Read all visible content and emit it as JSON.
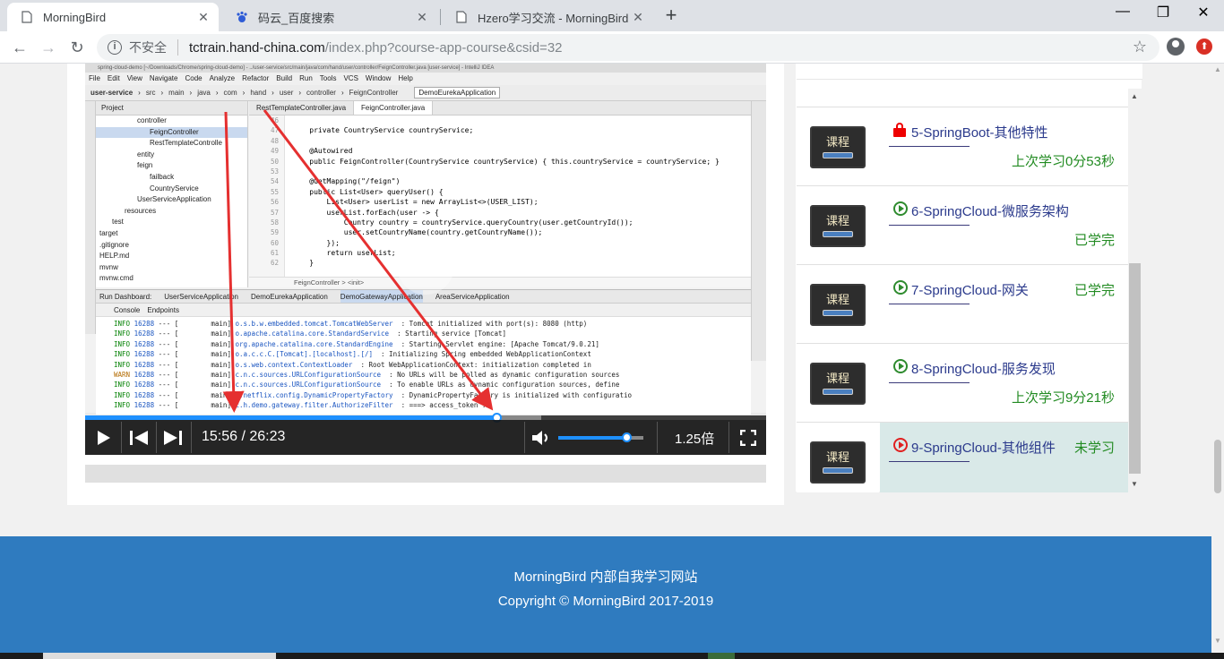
{
  "browser": {
    "tabs": [
      {
        "title": "MorningBird",
        "icon": "page-icon",
        "active": true
      },
      {
        "title": "码云_百度搜索",
        "icon": "baidu-paw-icon",
        "active": false
      },
      {
        "title": "Hzero学习交流 - MorningBird",
        "icon": "page-icon",
        "active": false
      }
    ],
    "new_tab": "+",
    "window_controls": {
      "minimize": "—",
      "restore": "❐",
      "close": "✕"
    },
    "nav": {
      "back": "←",
      "forward": "→",
      "reload": "↻"
    },
    "address": {
      "security_label": "不安全",
      "host": "tctrain.hand-china.com",
      "path": "/index.php?course-app-course&csid=32"
    }
  },
  "ide": {
    "window_title": "spring-cloud-demo [~/Downloads/Chrome/spring-cloud-demo] - ../user-service/src/main/java/com/hand/user/controller/FeignController.java [user-service] - IntelliJ IDEA",
    "menu": [
      "File",
      "Edit",
      "View",
      "Navigate",
      "Code",
      "Analyze",
      "Refactor",
      "Build",
      "Run",
      "Tools",
      "VCS",
      "Window",
      "Help"
    ],
    "breadcrumbs": [
      "user-service",
      "src",
      "main",
      "java",
      "com",
      "hand",
      "user",
      "controller",
      "FeignController"
    ],
    "run_config": "DemoEurekaApplication",
    "project_header": "Project",
    "tree": [
      {
        "label": "controller",
        "indent": 3,
        "selected": false
      },
      {
        "label": "FeignController",
        "indent": 4,
        "selected": true
      },
      {
        "label": "RestTemplateControlle",
        "indent": 4,
        "selected": false
      },
      {
        "label": "entity",
        "indent": 3,
        "selected": false
      },
      {
        "label": "feign",
        "indent": 3,
        "selected": false
      },
      {
        "label": "failback",
        "indent": 4,
        "selected": false
      },
      {
        "label": "CountryService",
        "indent": 4,
        "selected": false
      },
      {
        "label": "UserServiceApplication",
        "indent": 3,
        "selected": false
      },
      {
        "label": "resources",
        "indent": 2,
        "selected": false
      },
      {
        "label": "test",
        "indent": 1,
        "selected": false
      },
      {
        "label": "target",
        "indent": 0,
        "selected": false
      },
      {
        "label": ".gitignore",
        "indent": 0,
        "selected": false
      },
      {
        "label": "HELP.md",
        "indent": 0,
        "selected": false
      },
      {
        "label": "mvnw",
        "indent": 0,
        "selected": false
      },
      {
        "label": "mvnw.cmd",
        "indent": 0,
        "selected": false
      }
    ],
    "editor_tabs": [
      "RestTemplateController.java",
      "FeignController.java"
    ],
    "line_numbers": [
      "46",
      "47",
      "48",
      "49",
      "50",
      "53",
      "54",
      "55",
      "56",
      "57",
      "58",
      "59",
      "60",
      "61",
      "62"
    ],
    "code": [
      "",
      "    private CountryService countryService;",
      "",
      "    @Autowired",
      "    public FeignController(CountryService countryService) { this.countryService = countryService; }",
      "",
      "    @GetMapping(\"/feign\")",
      "    public List<User> queryUser() {",
      "        List<User> userList = new ArrayList<>(USER_LIST);",
      "        userList.forEach(user -> {",
      "            Country country = countryService.queryCountry(user.getCountryId());",
      "            user.setCountryName(country.getCountryName());",
      "        });",
      "        return userList;",
      "    }"
    ],
    "code_crumb": "FeignController   >   <init>",
    "run_dashboard": {
      "label": "Run Dashboard:",
      "apps": [
        "UserServiceApplication",
        "DemoEurekaApplication",
        "DemoGatewayApplication",
        "AreaServiceApplication"
      ],
      "subtabs": [
        "Console",
        "Endpoints"
      ],
      "logs": [
        {
          "lvl": "INFO",
          "pid": "16288",
          "thread": "main",
          "cls": "o.s.b.w.embedded.tomcat.TomcatWebServer",
          "msg": ": Tomcat initialized with port(s): 8080 (http)"
        },
        {
          "lvl": "INFO",
          "pid": "16288",
          "thread": "main",
          "cls": "o.apache.catalina.core.StandardService",
          "msg": ": Starting service [Tomcat]"
        },
        {
          "lvl": "INFO",
          "pid": "16288",
          "thread": "main",
          "cls": "org.apache.catalina.core.StandardEngine",
          "msg": ": Starting Servlet engine: [Apache Tomcat/9.0.21]"
        },
        {
          "lvl": "INFO",
          "pid": "16288",
          "thread": "main",
          "cls": "o.a.c.c.C.[Tomcat].[localhost].[/]",
          "msg": ": Initializing Spring embedded WebApplicationContext"
        },
        {
          "lvl": "INFO",
          "pid": "16288",
          "thread": "main",
          "cls": "o.s.web.context.ContextLoader",
          "msg": ": Root WebApplicationContext: initialization completed in"
        },
        {
          "lvl": "WARN",
          "pid": "16288",
          "thread": "main",
          "cls": "c.n.c.sources.URLConfigurationSource",
          "msg": ": No URLs will be polled as dynamic configuration sources"
        },
        {
          "lvl": "INFO",
          "pid": "16288",
          "thread": "main",
          "cls": "c.n.c.sources.URLConfigurationSource",
          "msg": ": To enable URLs as dynamic configuration sources, define"
        },
        {
          "lvl": "INFO",
          "pid": "16288",
          "thread": "main",
          "cls": "c.netflix.config.DynamicPropertyFactory",
          "msg": ": DynamicPropertyFactory is initialized with configuratio"
        },
        {
          "lvl": "INFO",
          "pid": "16288",
          "thread": "main",
          "cls": "c.h.demo.gateway.filter.AuthorizeFilter",
          "msg": ": ===> access_token :"
        }
      ]
    }
  },
  "player": {
    "current_time": "15:56",
    "duration": "26:23",
    "time_display": "15:56 / 26:23",
    "progress_fraction": 0.604,
    "buffered_fraction": 0.67,
    "volume_fraction": 0.8,
    "speed": "1.25倍",
    "icons": [
      "play-icon",
      "previous-icon",
      "next-icon",
      "volume-icon",
      "fullscreen-icon"
    ]
  },
  "courses": [
    {
      "title": "5-SpringBoot-其他特性",
      "status": "上次学习0分53秒",
      "status_position": "bottom",
      "icon": "lock-icon",
      "thumb_label": "课程",
      "current": false
    },
    {
      "title": "6-SpringCloud-微服务架构",
      "status": "已学完",
      "status_position": "bottom",
      "icon": "play-icon",
      "thumb_label": "课程",
      "current": false
    },
    {
      "title": "7-SpringCloud-网关",
      "status": "已学完",
      "status_position": "top",
      "icon": "play-icon",
      "thumb_label": "课程",
      "current": false
    },
    {
      "title": "8-SpringCloud-服务发现",
      "status": "上次学习9分21秒",
      "status_position": "bottom",
      "icon": "play-icon",
      "thumb_label": "课程",
      "current": false
    },
    {
      "title": "9-SpringCloud-其他组件",
      "status": "未学习",
      "status_position": "top",
      "icon": "play-red-icon",
      "thumb_label": "课程",
      "current": true
    }
  ],
  "footer": {
    "line1": "MorningBird 内部自我学习网站",
    "line2": "Copyright © MorningBird 2017-2019"
  }
}
